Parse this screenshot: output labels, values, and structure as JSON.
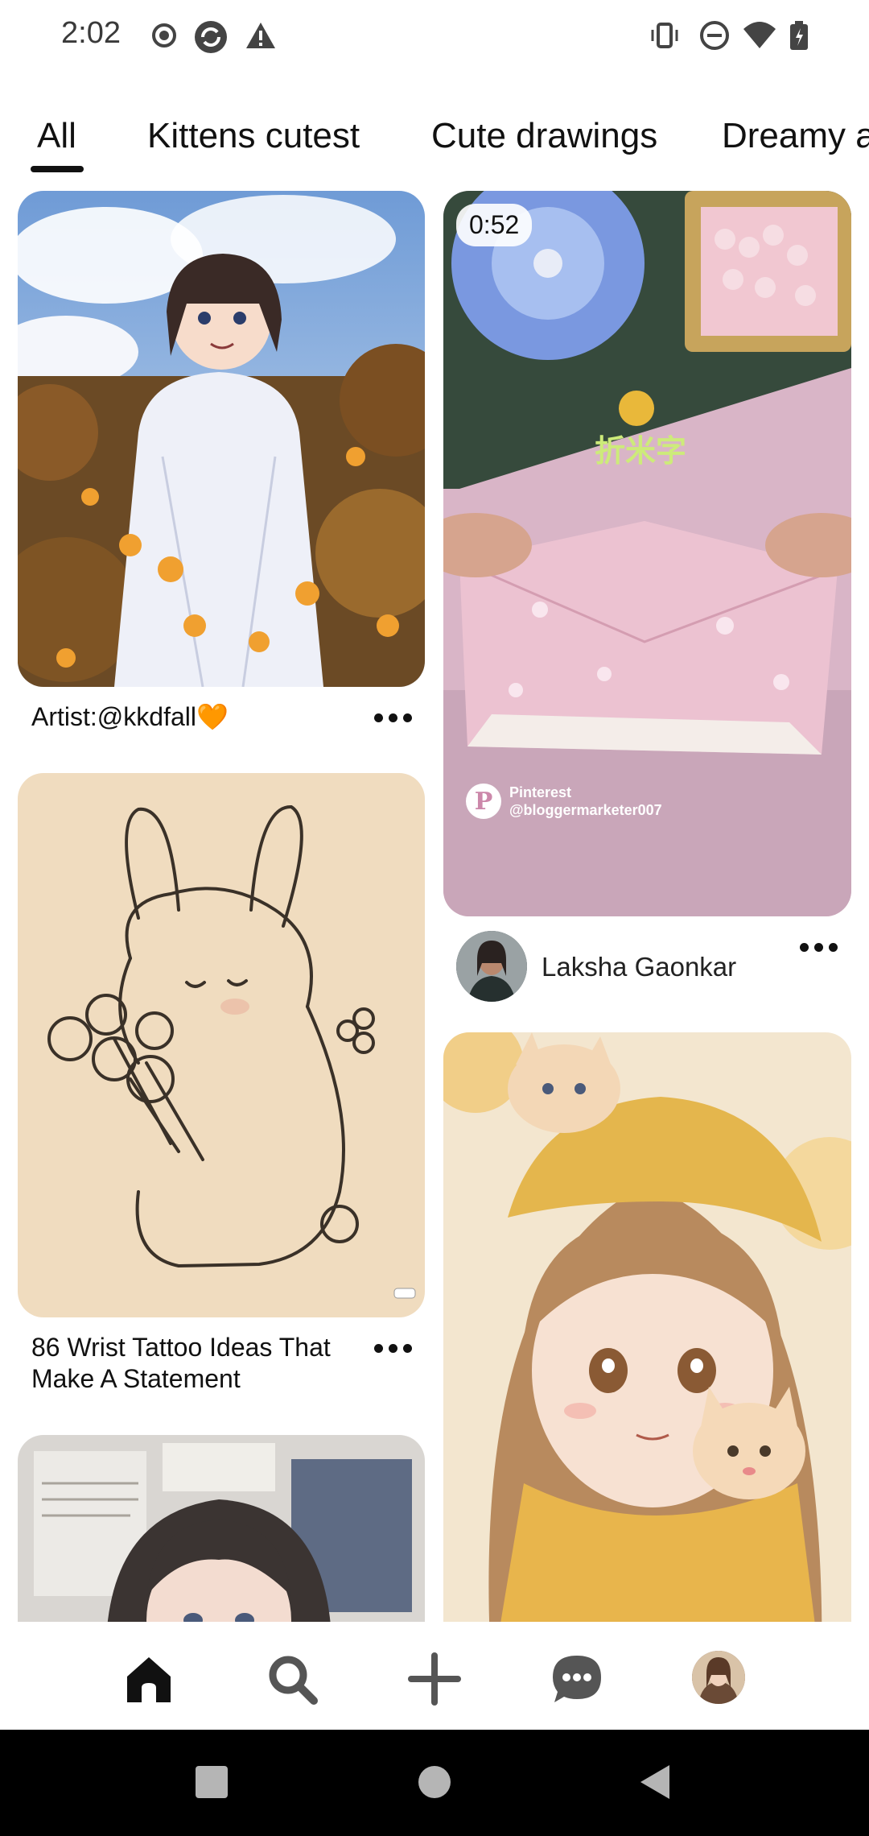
{
  "status_bar": {
    "time": "2:02",
    "left_icons": [
      "record-icon",
      "sync-icon",
      "warning-icon"
    ],
    "right_icons": [
      "vibrate-icon",
      "do-not-disturb-icon",
      "wifi-icon",
      "battery-icon"
    ]
  },
  "tabs": [
    {
      "label": "All",
      "active": true
    },
    {
      "label": "Kittens cutest",
      "active": false
    },
    {
      "label": "Cute drawings",
      "active": false
    },
    {
      "label": "Dreamy a",
      "active": false
    }
  ],
  "pins": {
    "pin1": {
      "caption": "Artist:@kkdfall🧡",
      "image": "anime-girl-flowers"
    },
    "pin2": {
      "caption_line1": "86 Wrist Tattoo Ideas That",
      "caption_line2": "Make A Statement",
      "image": "bunny-sketch"
    },
    "pin3": {
      "image": "anime-girl-newspaper"
    },
    "pin4": {
      "duration": "0:52",
      "image": "origami-video",
      "overlay_text": "折米字",
      "watermark_line1": "Pinterest",
      "watermark_line2": "@bloggermarketer007",
      "author": "Laksha Gaonkar"
    },
    "pin5": {
      "image": "anime-girl-kittens"
    }
  },
  "bottom_nav": [
    "home-icon",
    "search-icon",
    "create-icon",
    "messages-icon",
    "profile-avatar"
  ],
  "system_nav": [
    "recents-button",
    "home-button",
    "back-button"
  ],
  "colors": {
    "text": "#111111",
    "background": "#ffffff",
    "system_bar": "#000000"
  }
}
